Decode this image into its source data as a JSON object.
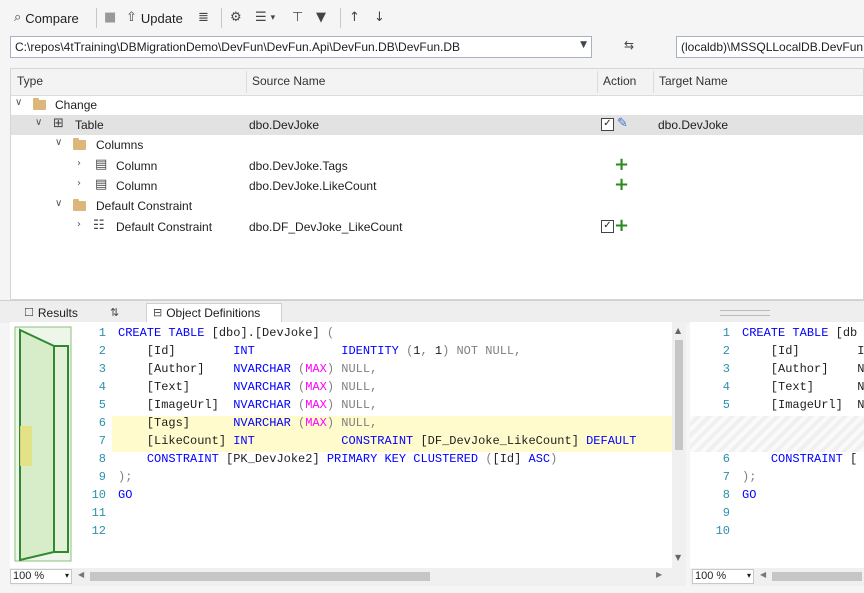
{
  "toolbar": {
    "compare_label": "Compare",
    "update_label": "Update"
  },
  "source_path": "C:\\repos\\4tTraining\\DBMigrationDemo\\DevFun\\DevFun.Api\\DevFun.DB\\DevFun.DB",
  "target_path": "(localdb)\\MSSQLLocalDB.DevFun",
  "grid": {
    "headers": {
      "type": "Type",
      "source": "Source Name",
      "action": "Action",
      "target": "Target Name"
    },
    "rows": [
      {
        "type": "Change",
        "source": "",
        "target": ""
      },
      {
        "type": "Table",
        "source": "dbo.DevJoke",
        "target": "dbo.DevJoke"
      },
      {
        "type": "Columns",
        "source": "",
        "target": ""
      },
      {
        "type": "Column",
        "source": "dbo.DevJoke.Tags",
        "target": ""
      },
      {
        "type": "Column",
        "source": "dbo.DevJoke.LikeCount",
        "target": ""
      },
      {
        "type": "Default Constraint",
        "source": "",
        "target": ""
      },
      {
        "type": "Default Constraint",
        "source": "dbo.DF_DevJoke_LikeCount",
        "target": ""
      }
    ]
  },
  "tabs": {
    "results": "Results",
    "object_definitions": "Object Definitions"
  },
  "code_left": {
    "line_numbers": [
      "1",
      "2",
      "3",
      "4",
      "5",
      "6",
      "7",
      "8",
      "9",
      "10",
      "11",
      "12"
    ],
    "lines": [
      "CREATE TABLE [dbo].[DevJoke] (",
      "    [Id]        INT            IDENTITY (1, 1) NOT NULL,",
      "    [Author]    NVARCHAR (MAX) NULL,",
      "    [Text]      NVARCHAR (MAX) NULL,",
      "    [ImageUrl]  NVARCHAR (MAX) NULL,",
      "    [Tags]      NVARCHAR (MAX) NULL,",
      "    [LikeCount] INT            CONSTRAINT [DF_DevJoke_LikeCount] DEFAULT",
      "    CONSTRAINT [PK_DevJoke2] PRIMARY KEY CLUSTERED ([Id] ASC)",
      ");",
      "GO",
      "",
      ""
    ]
  },
  "code_right": {
    "line_numbers": [
      "1",
      "2",
      "3",
      "4",
      "5",
      "",
      "",
      "6",
      "7",
      "8",
      "9",
      "10"
    ],
    "lines": [
      "CREATE TABLE [db",
      "    [Id]        I",
      "    [Author]    N",
      "    [Text]      N",
      "    [ImageUrl]  N",
      "",
      "",
      "    CONSTRAINT [",
      ");",
      "GO",
      "",
      ""
    ]
  },
  "zoom_left": "100 %",
  "zoom_right": "100 %",
  "colors": {
    "add_green": "#2b8a1f",
    "highlight": "#fffbcc",
    "keyword": "#0000ff"
  }
}
